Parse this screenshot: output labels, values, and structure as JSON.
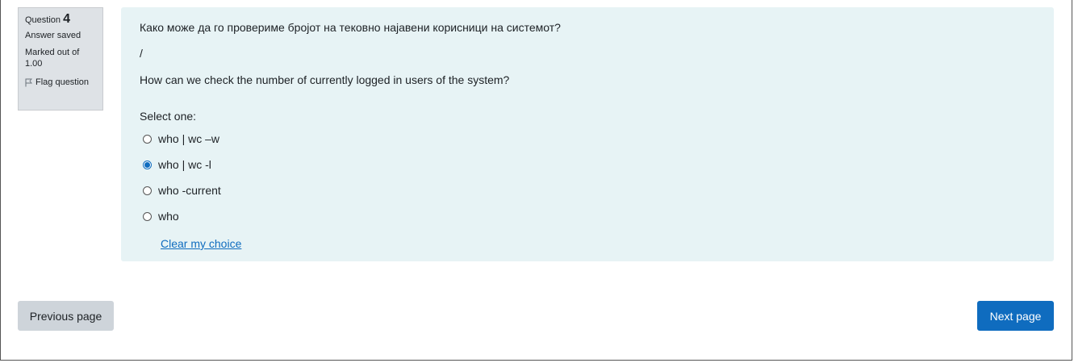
{
  "question_info": {
    "label": "Question",
    "number": "4",
    "state": "Answer saved",
    "grade": "Marked out of 1.00",
    "flag_label": "Flag question"
  },
  "question": {
    "text_mk": "Како може да го провериме бројот на тековно најавени корисници на системот?",
    "separator": "/",
    "text_en": "How can we check the number of currently logged in users of the system?",
    "prompt": "Select one:",
    "options": [
      {
        "label": "who | wc –w",
        "selected": false
      },
      {
        "label": "who | wc -l",
        "selected": true
      },
      {
        "label": "who -current",
        "selected": false
      },
      {
        "label": "who",
        "selected": false
      }
    ],
    "clear_label": "Clear my choice"
  },
  "navigation": {
    "previous_label": "Previous page",
    "next_label": "Next page"
  },
  "colors": {
    "content_bg": "#e7f3f5",
    "info_bg": "#dee2e6",
    "primary": "#0f6cbf",
    "secondary_button": "#ced4da"
  },
  "icons": {
    "flag": "flag-icon"
  }
}
